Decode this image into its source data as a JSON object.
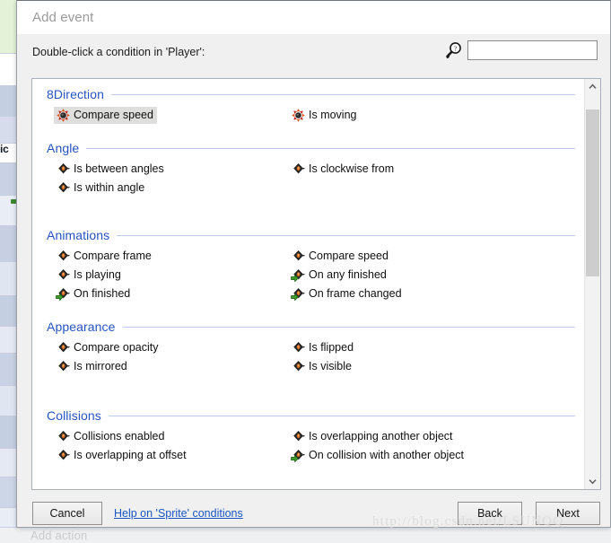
{
  "window": {
    "title": "Add event"
  },
  "background": {
    "add_action_label": "Add action",
    "text_fragment": "ic",
    "band_color": "#c3cde0",
    "band_alt_color": "#eef1f7"
  },
  "dialog": {
    "prompt": "Double-click a condition in 'Player':",
    "search": {
      "value": "",
      "placeholder": "",
      "icon": "magnifier-help-icon"
    }
  },
  "accent": {
    "section_title_color": "#2753c0",
    "rule_color": "#b9cbe8",
    "link_color": "#1a56c4",
    "selection_color": "#dededd"
  },
  "sections": [
    {
      "title": "8Direction",
      "items": [
        {
          "label": "Compare speed",
          "icon": "eight-direction-icon",
          "col": 0,
          "row": 0,
          "selected": true
        },
        {
          "label": "Is moving",
          "icon": "eight-direction-icon",
          "col": 1,
          "row": 0,
          "selected": false
        }
      ]
    },
    {
      "title": "Angle",
      "items": [
        {
          "label": "Is between angles",
          "icon": "sprite-icon",
          "col": 0,
          "row": 0,
          "selected": false
        },
        {
          "label": "Is clockwise from",
          "icon": "sprite-icon",
          "col": 1,
          "row": 0,
          "selected": false
        },
        {
          "label": "Is within angle",
          "icon": "sprite-icon",
          "col": 0,
          "row": 1,
          "selected": false
        }
      ]
    },
    {
      "title": "Animations",
      "items": [
        {
          "label": "Compare frame",
          "icon": "sprite-icon",
          "col": 0,
          "row": 0,
          "selected": false
        },
        {
          "label": "Compare speed",
          "icon": "sprite-icon",
          "col": 1,
          "row": 0,
          "selected": false
        },
        {
          "label": "Is playing",
          "icon": "sprite-icon",
          "col": 0,
          "row": 1,
          "selected": false
        },
        {
          "label": "On any finished",
          "icon": "sprite-trigger-icon",
          "col": 1,
          "row": 1,
          "selected": false
        },
        {
          "label": "On finished",
          "icon": "sprite-trigger-icon",
          "col": 0,
          "row": 2,
          "selected": false
        },
        {
          "label": "On frame changed",
          "icon": "sprite-trigger-icon",
          "col": 1,
          "row": 2,
          "selected": false
        }
      ]
    },
    {
      "title": "Appearance",
      "items": [
        {
          "label": "Compare opacity",
          "icon": "sprite-icon",
          "col": 0,
          "row": 0,
          "selected": false
        },
        {
          "label": "Is flipped",
          "icon": "sprite-icon",
          "col": 1,
          "row": 0,
          "selected": false
        },
        {
          "label": "Is mirrored",
          "icon": "sprite-icon",
          "col": 0,
          "row": 1,
          "selected": false
        },
        {
          "label": "Is visible",
          "icon": "sprite-icon",
          "col": 1,
          "row": 1,
          "selected": false
        }
      ]
    },
    {
      "title": "Collisions",
      "items": [
        {
          "label": "Collisions enabled",
          "icon": "sprite-icon",
          "col": 0,
          "row": 0,
          "selected": false
        },
        {
          "label": "Is overlapping another object",
          "icon": "sprite-icon",
          "col": 1,
          "row": 0,
          "selected": false
        },
        {
          "label": "Is overlapping at offset",
          "icon": "sprite-icon",
          "col": 0,
          "row": 1,
          "selected": false
        },
        {
          "label": "On collision with another object",
          "icon": "sprite-trigger-icon",
          "col": 1,
          "row": 1,
          "selected": false
        }
      ]
    }
  ],
  "scrollbar": {
    "up_arrow": "chevron-up-icon",
    "down_arrow": "chevron-down-icon",
    "thumb_top_pct": 4,
    "thumb_height_pct": 44
  },
  "footer": {
    "cancel_label": "Cancel",
    "help_link_label": "Help on 'Sprite' conditions",
    "back_label": "Back",
    "next_label": "Next"
  },
  "watermark": {
    "text": "http://blog.csdn.net/LSUNQQ"
  }
}
